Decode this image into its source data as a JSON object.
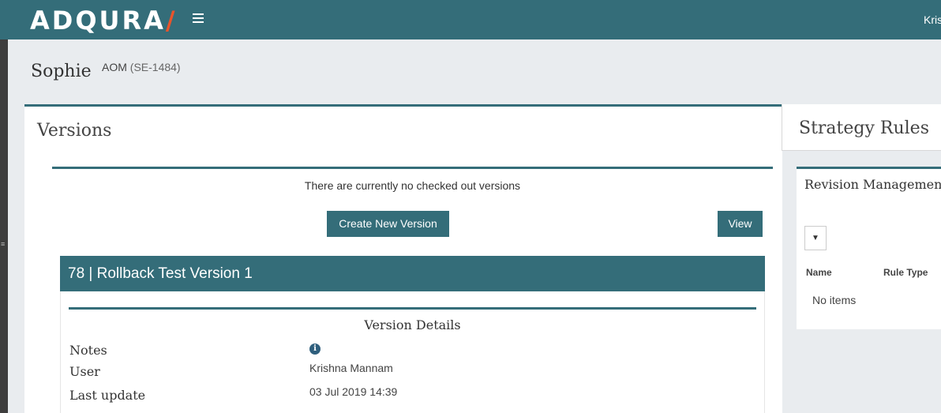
{
  "topbar": {
    "logo_text": "ADQURA",
    "logo_slash": "/",
    "menu_icon": "hamburger-menu-icon",
    "user_name": "Kris"
  },
  "page": {
    "title": "Sophie",
    "subtitle_label": "AOM",
    "subtitle_code": "(SE-1484)"
  },
  "versions": {
    "title": "Versions",
    "no_checkout_message": "There are currently no checked out versions",
    "create_button": "Create New Version",
    "view_button": "View",
    "current_version": "78 | Rollback Test Version 1",
    "details": {
      "title": "Version Details",
      "notes_label": "Notes",
      "notes_icon": "info-icon",
      "user_label": "User",
      "user_value": "Krishna Mannam",
      "last_update_label": "Last update",
      "last_update_value": "03 Jul 2019 14:39"
    }
  },
  "strategy": {
    "title": "Strategy Rules",
    "revision_title": "Revision Management",
    "dropdown_caret": "▼",
    "columns": [
      "Name",
      "Rule Type"
    ],
    "empty_message": "No items"
  },
  "colors": {
    "brand": "#346d79",
    "logo_accent": "#e8542b",
    "background": "#e9ecef"
  }
}
